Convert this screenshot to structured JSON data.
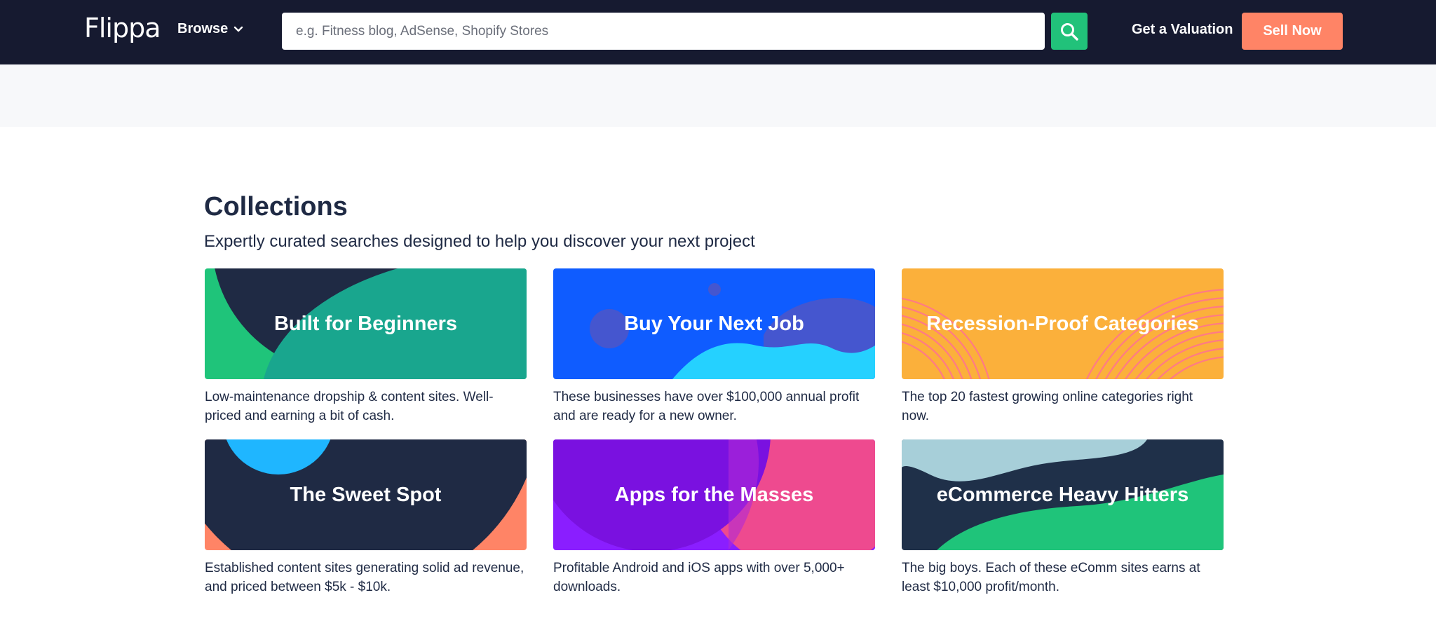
{
  "header": {
    "logo": "Flippa",
    "browse_label": "Browse",
    "search_placeholder": "e.g. Fitness blog, AdSense, Shopify Stores",
    "valuation_label": "Get a Valuation",
    "sell_label": "Sell Now"
  },
  "collections": {
    "title": "Collections",
    "subtitle": "Expertly curated searches designed to help you discover your next project",
    "items": [
      {
        "title": "Built for Beginners",
        "description": "Low-maintenance dropship & content sites. Well-priced and earning a bit of cash."
      },
      {
        "title": "Buy Your Next Job",
        "description": "These businesses have over $100,000 annual profit and are ready for a new owner."
      },
      {
        "title": "Recession-Proof Categories",
        "description": "The top 20 fastest growing online categories right now."
      },
      {
        "title": "The Sweet Spot",
        "description": "Established content sites generating solid ad revenue, and priced between $5k - $10k."
      },
      {
        "title": "Apps for the Masses",
        "description": "Profitable Android and iOS apps with over 5,000+ downloads."
      },
      {
        "title": "eCommerce Heavy Hitters",
        "description": "The big boys. Each of these eComm sites earns at least $10,000 profit/month."
      }
    ]
  },
  "colors": {
    "navbar": "#161a30",
    "search_button": "#21c27a",
    "sell_button": "#ff8466",
    "heading_text": "#1f2a44"
  }
}
